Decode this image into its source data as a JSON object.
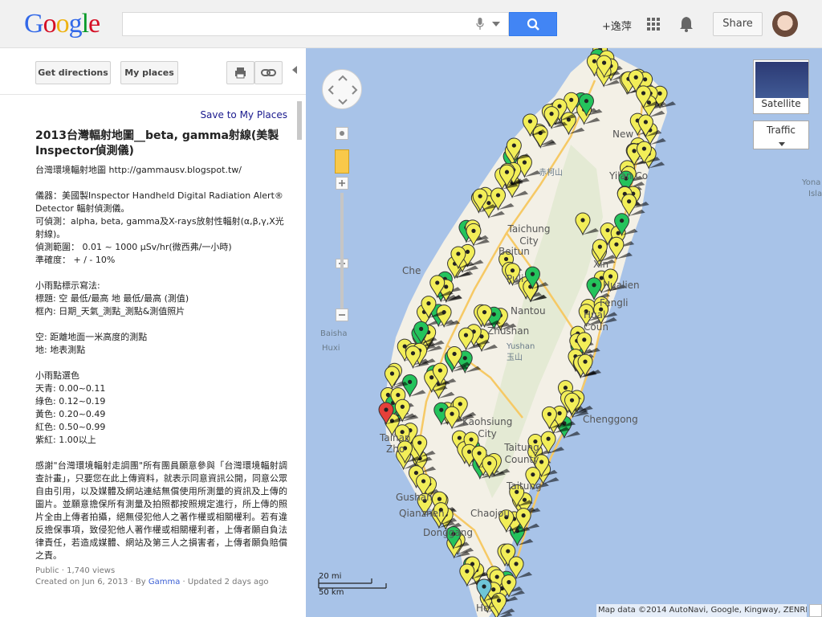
{
  "header": {
    "logo_letters": [
      "G",
      "o",
      "o",
      "g",
      "l",
      "e"
    ],
    "search_value": "",
    "plus_label": "+逸萍",
    "share_label": "Share"
  },
  "toolbar": {
    "directions_label": "Get directions",
    "my_places_label": "My places"
  },
  "panel": {
    "save_label": "Save to My Places",
    "title": "2013台灣輻射地圖__beta, gamma射線(美製 Inspector偵測儀)",
    "intro": "台灣環境輻射地圖 http://gammausv.blogspot.tw/",
    "instrument": [
      "儀器：美國製Inspector Handheld Digital Radiation Alert® Detector 輻射偵測儀。",
      "可偵測：alpha, beta, gamma及X-rays放射性輻射(α,β,γ,X光射線)。",
      "偵測範圍： 0.01 ~ 1000 μSv/hr(微西弗/一小時)",
      "準確度： + / - 10%"
    ],
    "legend_heading": "小雨點標示寫法:",
    "legend_lines": [
      "標題: 空 最低/最高 地 最低/最高 (測值)",
      "框內: 日期_天氣_測點_測點&測值照片"
    ],
    "def_lines": [
      "空: 距離地面一米高度的測點",
      "地: 地表測點"
    ],
    "color_heading": "小雨點選色",
    "colors": [
      "天青: 0.00~0.11",
      "綠色: 0.12~0.19",
      "黃色: 0.20~0.49",
      "紅色: 0.50~0.99",
      "紫紅: 1.00以上"
    ],
    "thanks": "感謝\"台灣環境輻射走調團\"所有團員願意參與「台灣環境輻射調查計畫」，只要您在此上傳資料，就表示同意資訊公開，同意公眾自由引用，以及媒體及網站連結無償使用所測量的資訊及上傳的圖片。並願意擔保所有測量及拍照都按照規定進行，所上傳的照片全由上傳者拍攝，絕無侵犯他人之著作權或相關權利。若有違反擔保事項，致侵犯他人著作權或相關權利者，上傳者願自負法律責任，若造成媒體、網站及第三人之損害者，上傳者願負賠償之責。",
    "meta_line1": "Public · 1,740 views",
    "meta_created": "Created on Jun 6, 2013 · By ",
    "meta_author": "Gamma",
    "meta_updated": " · Updated 2 days ago"
  },
  "map": {
    "place_labels": [
      {
        "text": "赤柯山",
        "cls": "sm"
      },
      {
        "text": "New",
        "cls": ""
      },
      {
        "text": "Yilan Co",
        "cls": ""
      },
      {
        "text": "Yona",
        "cls": "sm"
      },
      {
        "text": "Isla",
        "cls": "sm"
      },
      {
        "text": "Taichung City",
        "cls": ""
      },
      {
        "text": "Beitun",
        "cls": ""
      },
      {
        "text": "Che",
        "cls": ""
      },
      {
        "text": "Puli",
        "cls": ""
      },
      {
        "text": "Xin",
        "cls": ""
      },
      {
        "text": "Hualien",
        "cls": ""
      },
      {
        "text": "Fengli",
        "cls": ""
      },
      {
        "text": "Hual",
        "cls": ""
      },
      {
        "text": "Coun",
        "cls": ""
      },
      {
        "text": "Nantou",
        "cls": ""
      },
      {
        "text": "Zhushan",
        "cls": ""
      },
      {
        "text": "Yushan",
        "cls": "sm"
      },
      {
        "text": "玉山",
        "cls": "sm"
      },
      {
        "text": "Baisha",
        "cls": "sm"
      },
      {
        "text": "Huxi",
        "cls": "sm"
      },
      {
        "text": "Tainan",
        "cls": ""
      },
      {
        "text": "Zho",
        "cls": ""
      },
      {
        "text": "Kaohsiung City",
        "cls": ""
      },
      {
        "text": "Taitung County",
        "cls": ""
      },
      {
        "text": "Taitung",
        "cls": ""
      },
      {
        "text": "Chenggong",
        "cls": ""
      },
      {
        "text": "Gushan",
        "cls": ""
      },
      {
        "text": "Qianzhen",
        "cls": ""
      },
      {
        "text": "Chaojou",
        "cls": ""
      },
      {
        "text": "Donggang",
        "cls": ""
      },
      {
        "text": "He",
        "cls": ""
      }
    ],
    "satellite_label": "Satellite",
    "traffic_label": "Traffic",
    "scale_mi": "20 mi",
    "scale_km": "50 km",
    "attribution": "Map data ©2014 AutoNavi, Google, Kingway, ZENRIN -",
    "colors": {
      "sea": "#a8c3e8",
      "land": "#f3f0e6",
      "mountain": "#e4ead4",
      "road": "#f6c965",
      "pin_yellow": "#f2ee58",
      "pin_green": "#24c35c",
      "pin_red": "#e5403a",
      "pin_cyan": "#6ec6d8"
    }
  }
}
